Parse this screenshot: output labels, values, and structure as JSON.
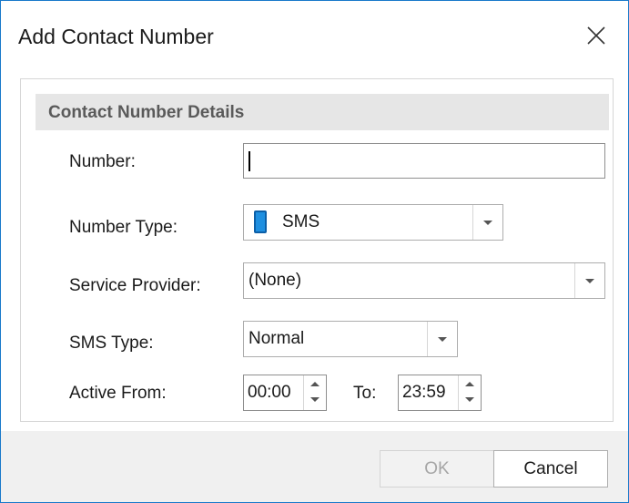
{
  "window": {
    "title": "Add Contact Number"
  },
  "group": {
    "title": "Contact Number Details"
  },
  "fields": {
    "number": {
      "label": "Number:",
      "value": ""
    },
    "number_type": {
      "label": "Number Type:",
      "value": "SMS",
      "icon": "mobile-phone-icon"
    },
    "service_provider": {
      "label": "Service Provider:",
      "value": "(None)"
    },
    "sms_type": {
      "label": "SMS Type:",
      "value": "Normal"
    },
    "active_from": {
      "label": "Active From:",
      "value": "00:00"
    },
    "active_to": {
      "label": "To:",
      "value": "23:59"
    }
  },
  "buttons": {
    "ok": "OK",
    "cancel": "Cancel"
  },
  "colors": {
    "window_border": "#1979ca",
    "phone_icon": "#1e8fe0",
    "disabled_text": "#a6a6a6"
  }
}
